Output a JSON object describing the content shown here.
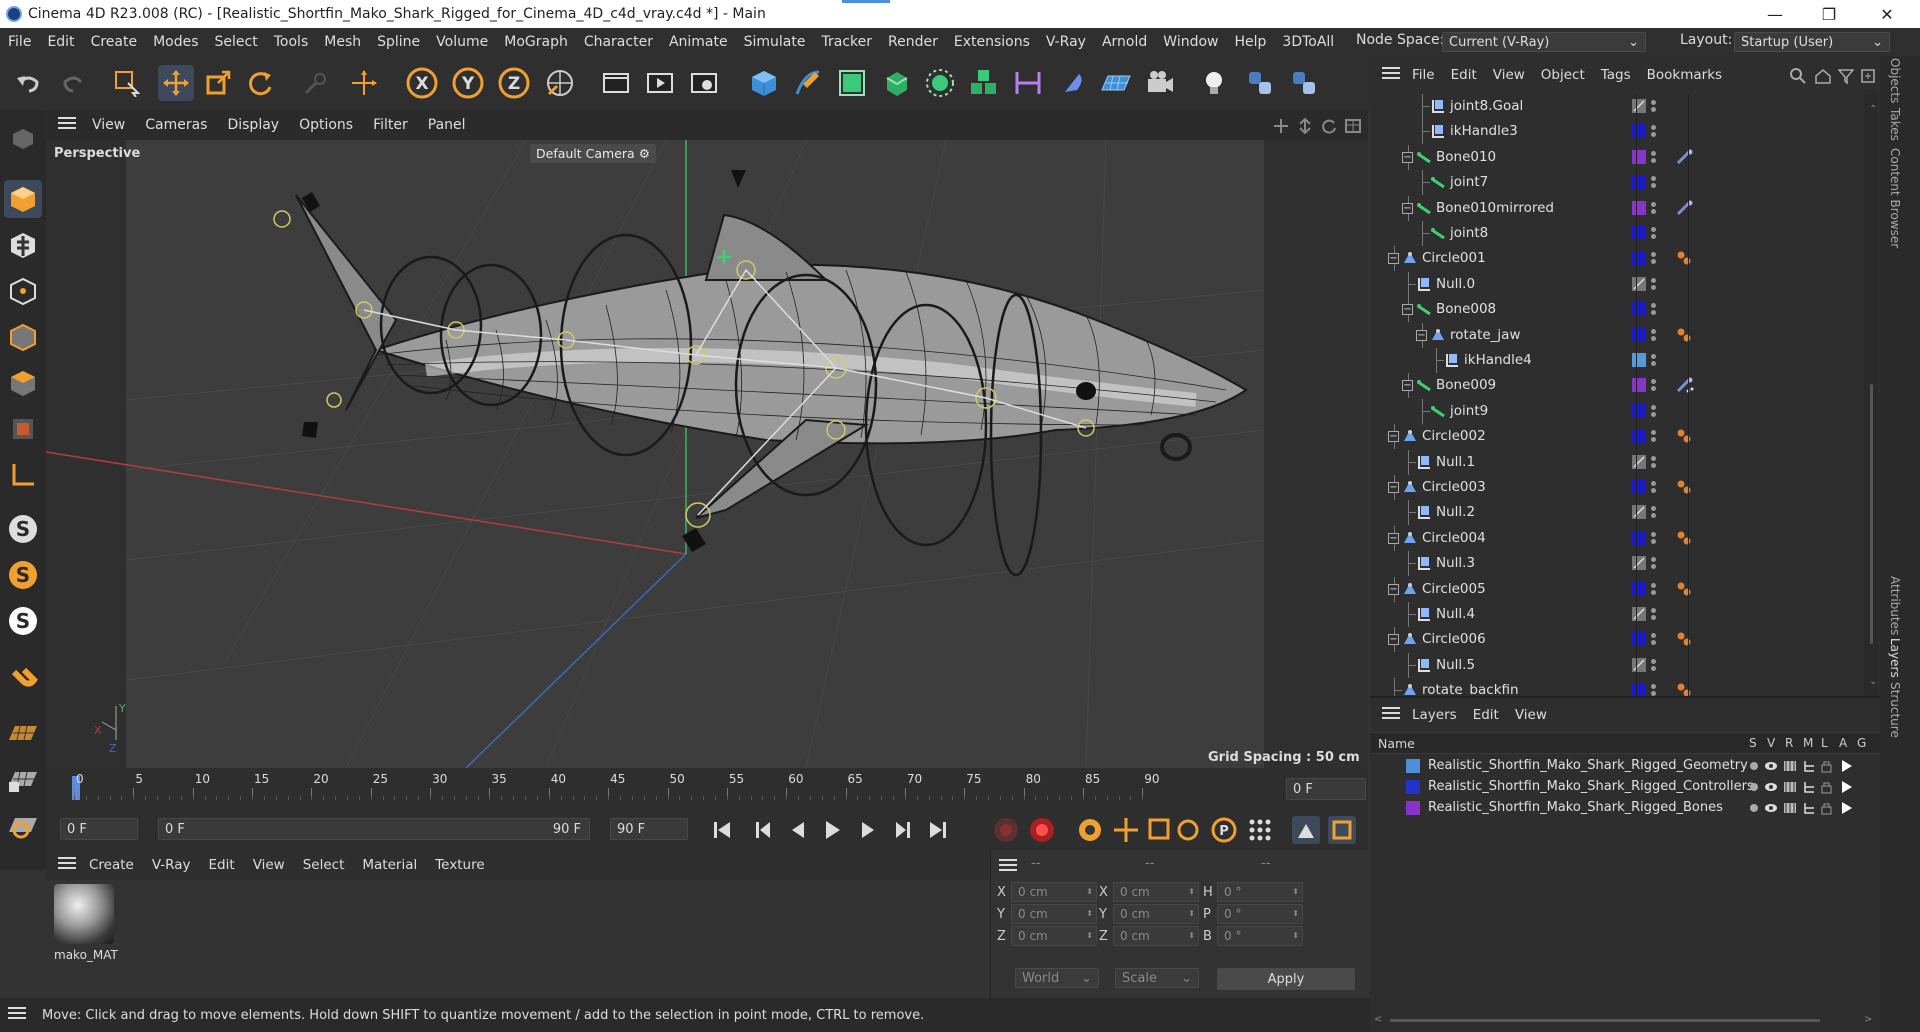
{
  "window": {
    "title": "Cinema 4D R23.008 (RC) - [Realistic_Shortfin_Mako_Shark_Rigged_for_Cinema_4D_c4d_vray.c4d *] - Main"
  },
  "menu": [
    "File",
    "Edit",
    "Create",
    "Modes",
    "Select",
    "Tools",
    "Mesh",
    "Spline",
    "Volume",
    "MoGraph",
    "Character",
    "Animate",
    "Simulate",
    "Tracker",
    "Render",
    "Extensions",
    "V-Ray",
    "Arnold",
    "Window",
    "Help",
    "3DToAll"
  ],
  "nodespace": {
    "label": "Node Space:",
    "value": "Current (V-Ray)"
  },
  "layout": {
    "label": "Layout:",
    "value": "Startup (User)"
  },
  "viewport": {
    "menu": [
      "View",
      "Cameras",
      "Display",
      "Options",
      "Filter",
      "Panel"
    ],
    "label": "Perspective",
    "camera": "Default Camera",
    "grid": "Grid Spacing : 50 cm"
  },
  "timeline": {
    "ticks": [
      "0",
      "5",
      "10",
      "15",
      "20",
      "25",
      "30",
      "35",
      "40",
      "45",
      "50",
      "55",
      "60",
      "65",
      "70",
      "75",
      "80",
      "85",
      "90"
    ],
    "frame": "0 F"
  },
  "playback": {
    "start": "0 F",
    "range_start": "0 F",
    "range_end": "90 F",
    "end": "90 F"
  },
  "material": {
    "menu": [
      "Create",
      "V-Ray",
      "Edit",
      "View",
      "Select",
      "Material",
      "Texture"
    ],
    "name": "mako_MAT"
  },
  "coords": {
    "headers": [
      "--",
      "--",
      "--"
    ],
    "rows": [
      [
        "X",
        "0 cm",
        "X",
        "0 cm",
        "H",
        "0 °"
      ],
      [
        "Y",
        "0 cm",
        "Y",
        "0 cm",
        "P",
        "0 °"
      ],
      [
        "Z",
        "0 cm",
        "Z",
        "0 cm",
        "B",
        "0 °"
      ]
    ],
    "world": "World",
    "scale": "Scale",
    "apply": "Apply"
  },
  "status": "Move: Click and drag to move elements. Hold down SHIFT to quantize movement / add to the selection in point mode, CTRL to remove.",
  "objects": {
    "menu": [
      "File",
      "Edit",
      "View",
      "Object",
      "Tags",
      "Bookmarks"
    ],
    "rows": [
      {
        "name": "joint8.Goal",
        "indent": 3,
        "icon": "null",
        "color": "#777777",
        "tag": ""
      },
      {
        "name": "ikHandle3",
        "indent": 3,
        "icon": "null",
        "color": "#1a1acc",
        "tag": ""
      },
      {
        "name": "Bone010",
        "indent": 2,
        "icon": "bone",
        "color": "#8833cc",
        "tag": "ik"
      },
      {
        "name": "joint7",
        "indent": 3,
        "icon": "bone",
        "color": "#1a1acc",
        "tag": ""
      },
      {
        "name": "Bone010mirrored",
        "indent": 2,
        "icon": "bone",
        "color": "#8833cc",
        "tag": "ik"
      },
      {
        "name": "joint8",
        "indent": 3,
        "icon": "bone",
        "color": "#1a1acc",
        "tag": ""
      },
      {
        "name": "Circle001",
        "indent": 1,
        "icon": "spline",
        "color": "#1a1acc",
        "tag": "dots"
      },
      {
        "name": "Null.0",
        "indent": 2,
        "icon": "null",
        "color": "#777777",
        "tag": ""
      },
      {
        "name": "Bone008",
        "indent": 2,
        "icon": "bone",
        "color": "#1a1acc",
        "tag": ""
      },
      {
        "name": "rotate_jaw",
        "indent": 3,
        "icon": "spline",
        "color": "#1a1acc",
        "tag": "dots"
      },
      {
        "name": "ikHandle4",
        "indent": 4,
        "icon": "null",
        "color": "#5599dd",
        "tag": ""
      },
      {
        "name": "Bone009",
        "indent": 2,
        "icon": "bone",
        "color": "#8833cc",
        "tag": "ik2"
      },
      {
        "name": "joint9",
        "indent": 3,
        "icon": "bone",
        "color": "#1a1acc",
        "tag": ""
      },
      {
        "name": "Circle002",
        "indent": 1,
        "icon": "spline",
        "color": "#1a1acc",
        "tag": "dots"
      },
      {
        "name": "Null.1",
        "indent": 2,
        "icon": "null",
        "color": "#777777",
        "tag": ""
      },
      {
        "name": "Circle003",
        "indent": 1,
        "icon": "spline",
        "color": "#1a1acc",
        "tag": "dots"
      },
      {
        "name": "Null.2",
        "indent": 2,
        "icon": "null",
        "color": "#777777",
        "tag": ""
      },
      {
        "name": "Circle004",
        "indent": 1,
        "icon": "spline",
        "color": "#1a1acc",
        "tag": "dots"
      },
      {
        "name": "Null.3",
        "indent": 2,
        "icon": "null",
        "color": "#777777",
        "tag": ""
      },
      {
        "name": "Circle005",
        "indent": 1,
        "icon": "spline",
        "color": "#1a1acc",
        "tag": "dots"
      },
      {
        "name": "Null.4",
        "indent": 2,
        "icon": "null",
        "color": "#777777",
        "tag": ""
      },
      {
        "name": "Circle006",
        "indent": 1,
        "icon": "spline",
        "color": "#1a1acc",
        "tag": "dots"
      },
      {
        "name": "Null.5",
        "indent": 2,
        "icon": "null",
        "color": "#777777",
        "tag": ""
      },
      {
        "name": "rotate_backfin",
        "indent": 1,
        "icon": "spline",
        "color": "#1a1acc",
        "tag": "dots"
      }
    ]
  },
  "layers": {
    "menu": [
      "Layers",
      "Edit",
      "View"
    ],
    "header": {
      "name": "Name",
      "cols": [
        "S",
        "V",
        "R",
        "M",
        "L",
        "A",
        "G"
      ]
    },
    "rows": [
      {
        "name": "Realistic_Shortfin_Mako_Shark_Rigged_Geometry",
        "color": "#4a8fd8"
      },
      {
        "name": "Realistic_Shortfin_Mako_Shark_Rigged_Controllers",
        "color": "#2233cc"
      },
      {
        "name": "Realistic_Shortfin_Mako_Shark_Rigged_Bones",
        "color": "#8833cc"
      }
    ]
  },
  "side_tabs": [
    "Objects",
    "Takes",
    "Content Browser",
    "Attributes",
    "Layers",
    "Structure"
  ]
}
